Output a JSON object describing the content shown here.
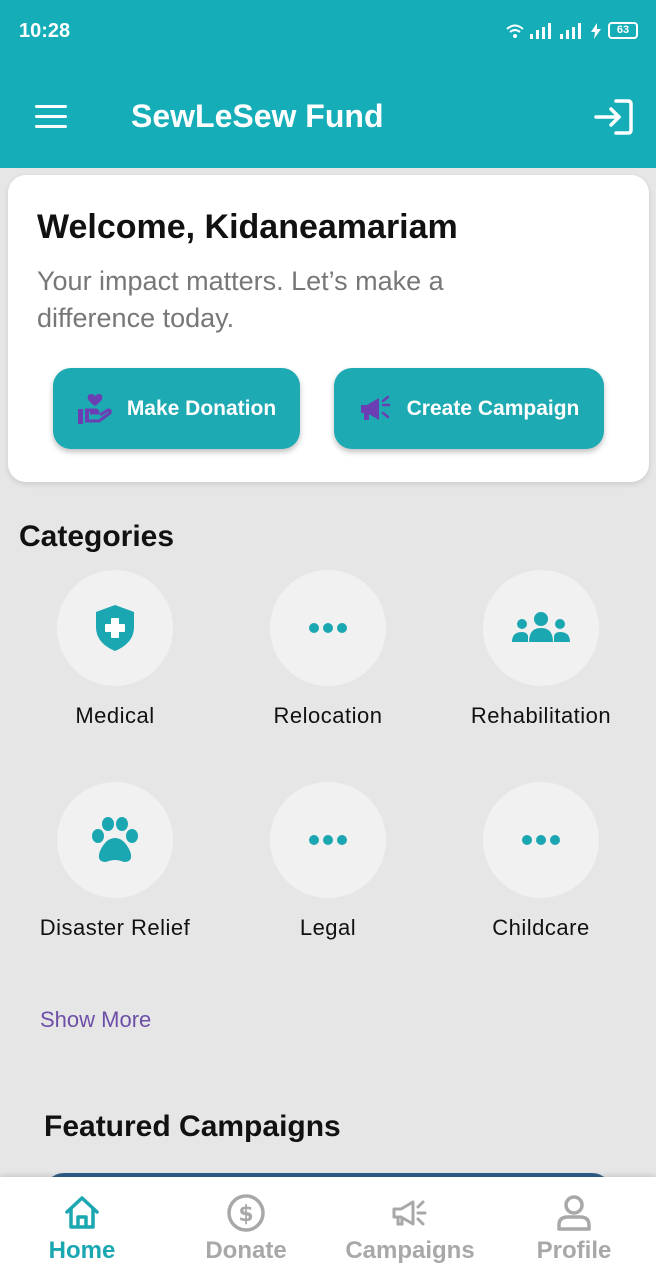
{
  "status_bar": {
    "time": "10:28",
    "battery": "63"
  },
  "app_bar": {
    "title": "SewLeSew Fund"
  },
  "welcome": {
    "title": "Welcome, Kidaneamariam",
    "subtitle": "Your impact matters. Let’s make a difference today.",
    "donate_label": "Make Donation",
    "campaign_label": "Create Campaign"
  },
  "categories": {
    "title": "Categories",
    "items": [
      {
        "label": "Medical",
        "icon": "shield-plus-icon"
      },
      {
        "label": "Relocation",
        "icon": "more-dots-icon"
      },
      {
        "label": "Rehabilitation",
        "icon": "group-icon"
      },
      {
        "label": "Disaster Relief",
        "icon": "paw-icon"
      },
      {
        "label": "Legal",
        "icon": "more-dots-icon"
      },
      {
        "label": "Childcare",
        "icon": "more-dots-icon"
      }
    ],
    "show_more": "Show More"
  },
  "featured": {
    "title": "Featured Campaigns"
  },
  "bottom_nav": {
    "items": [
      {
        "label": "Home",
        "icon": "home-icon",
        "active": true
      },
      {
        "label": "Donate",
        "icon": "dollar-circle-icon",
        "active": false
      },
      {
        "label": "Campaigns",
        "icon": "megaphone-icon",
        "active": false
      },
      {
        "label": "Profile",
        "icon": "person-icon",
        "active": false
      }
    ]
  },
  "colors": {
    "primary": "#15adb7",
    "button": "#1eaab2",
    "accent_purple": "#6e4fa8",
    "background": "#e6e6e6"
  }
}
